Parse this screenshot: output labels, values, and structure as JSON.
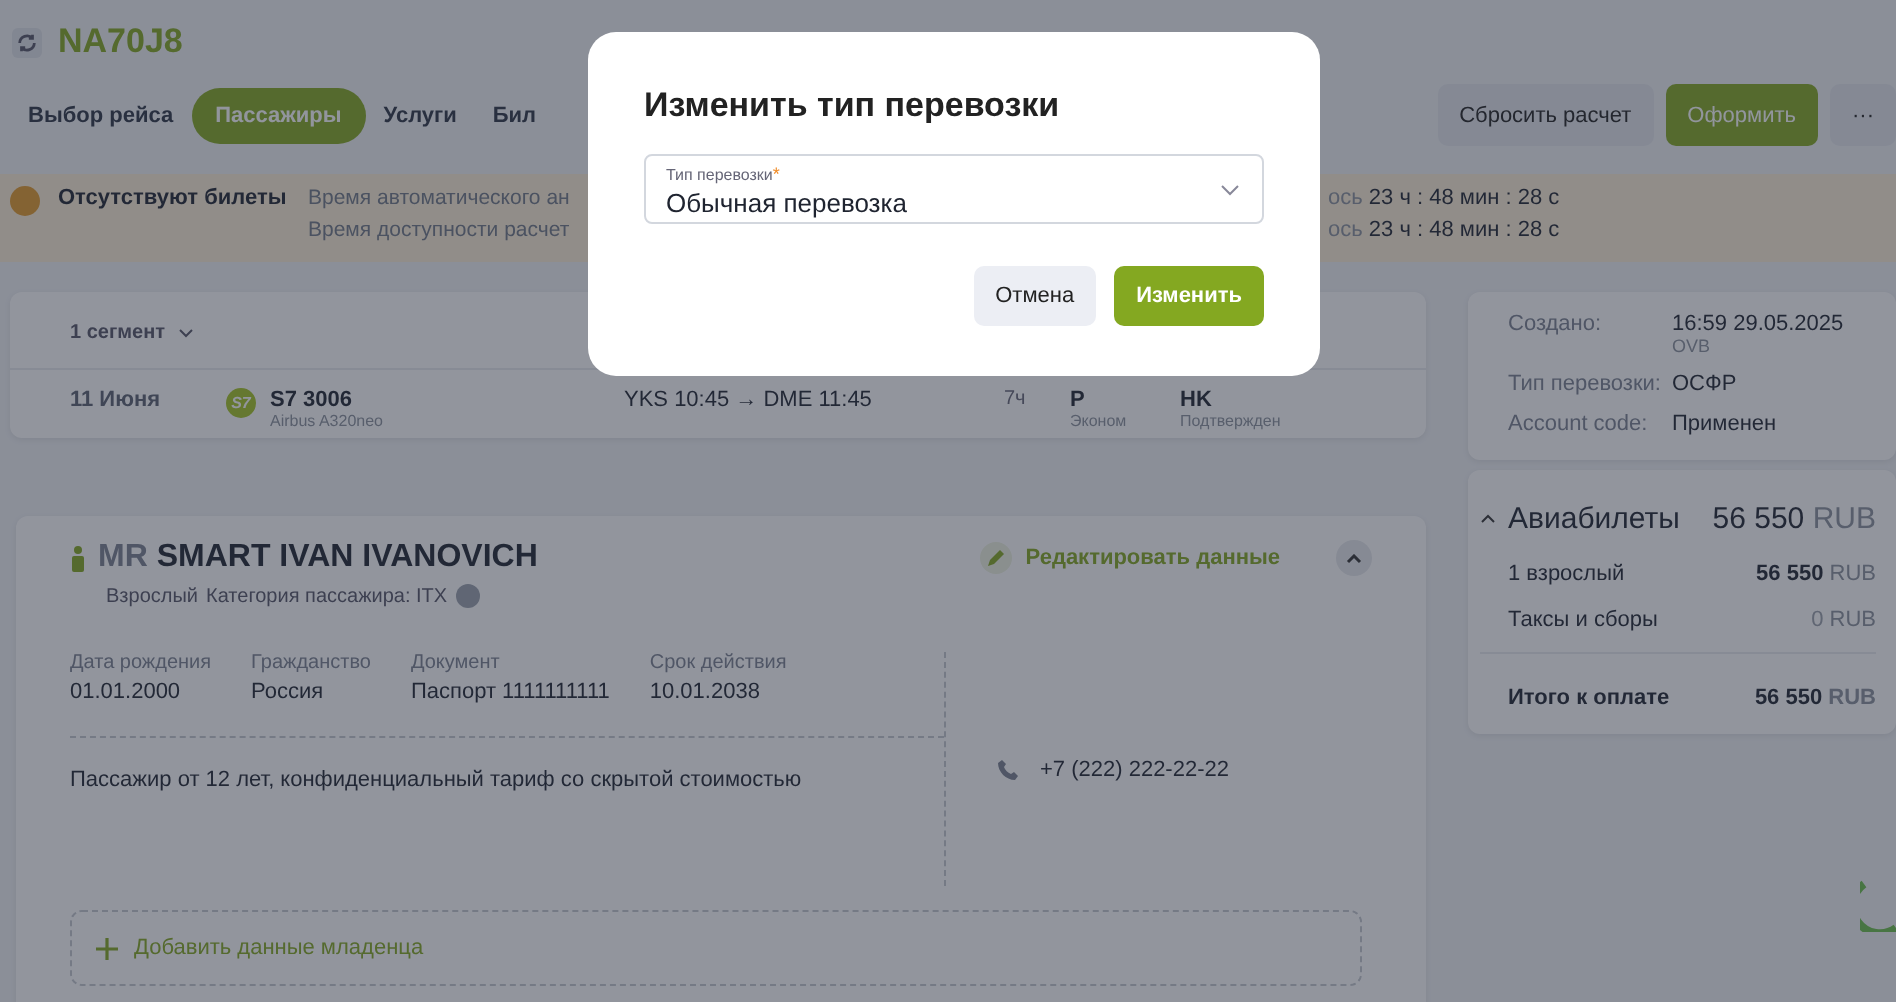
{
  "header": {
    "booking_code": "NA70J8"
  },
  "tabs": [
    {
      "label": "Выбор рейса",
      "selected": false
    },
    {
      "label": "Пассажиры",
      "selected": true
    },
    {
      "label": "Услуги",
      "selected": false
    },
    {
      "label": "Бил",
      "selected": false
    }
  ],
  "actions": {
    "reset": "Сбросить расчет",
    "issue": "Оформить",
    "more": "···"
  },
  "alert": {
    "title": "Отсутствуют билеты",
    "lines": [
      {
        "left": "Время автоматического ан",
        "right_prefix": "ось",
        "right": "23 ч : 48 мин : 28 с"
      },
      {
        "left": "Время доступности расчет",
        "right_prefix": "ось",
        "right": "23 ч : 48 мин : 28 с"
      }
    ]
  },
  "segments": {
    "toggle": "1 сегмент",
    "flights": [
      {
        "date": "11 Июня",
        "airline_logo": "S7",
        "flight": "S7 3006",
        "aircraft": "Airbus A320neo",
        "from": "YKS 10:45",
        "arrow": "→",
        "to": "DME 11:45",
        "duration": "7ч",
        "class_code": "P",
        "class_name": "Эконом",
        "status_code": "HK",
        "status_name": "Подтвержден"
      }
    ]
  },
  "passenger": {
    "title": "MR",
    "name": "SMART IVAN IVANOVICH",
    "type": "Взрослый",
    "category": "Категория пассажира: ITX",
    "edit": "Редактировать данные",
    "expanded": true,
    "fields": [
      {
        "label": "Дата рождения",
        "value": "01.01.2000"
      },
      {
        "label": "Гражданство",
        "value": "Россия"
      },
      {
        "label": "Документ",
        "value": "Паспорт 1111111111"
      },
      {
        "label": "Срок действия",
        "value": "10.01.2038"
      }
    ],
    "phone": "+7 (222) 222-22-22",
    "note": "Пассажир от 12 лет, конфиденциальный тариф со скрытой стоимостью",
    "add_infant": "Добавить данные младенца"
  },
  "order_info": [
    {
      "label": "Создано:",
      "value": "16:59 29.05.2025",
      "sub": "OVB"
    },
    {
      "label": "Тип перевозки:",
      "value": "ОСФР"
    },
    {
      "label": "Account code:",
      "value": "Применен"
    }
  ],
  "price": {
    "title": "Авиабилеты",
    "expanded": true,
    "amount": "56 550",
    "currency": "RUB",
    "lines": [
      {
        "label": "1 взрослый",
        "amount": "56 550",
        "currency": "RUB",
        "zero": false
      },
      {
        "label": "Таксы и сборы",
        "amount": "0",
        "currency": "RUB",
        "zero": true
      }
    ],
    "total_label": "Итого к оплате",
    "total": "56 550",
    "total_currency": "RUB"
  },
  "dialog": {
    "title": "Изменить тип перевозки",
    "field_label": "Тип перевозки",
    "required_mark": "*",
    "value": "Обычная перевозка",
    "cancel": "Отмена",
    "confirm": "Изменить"
  }
}
